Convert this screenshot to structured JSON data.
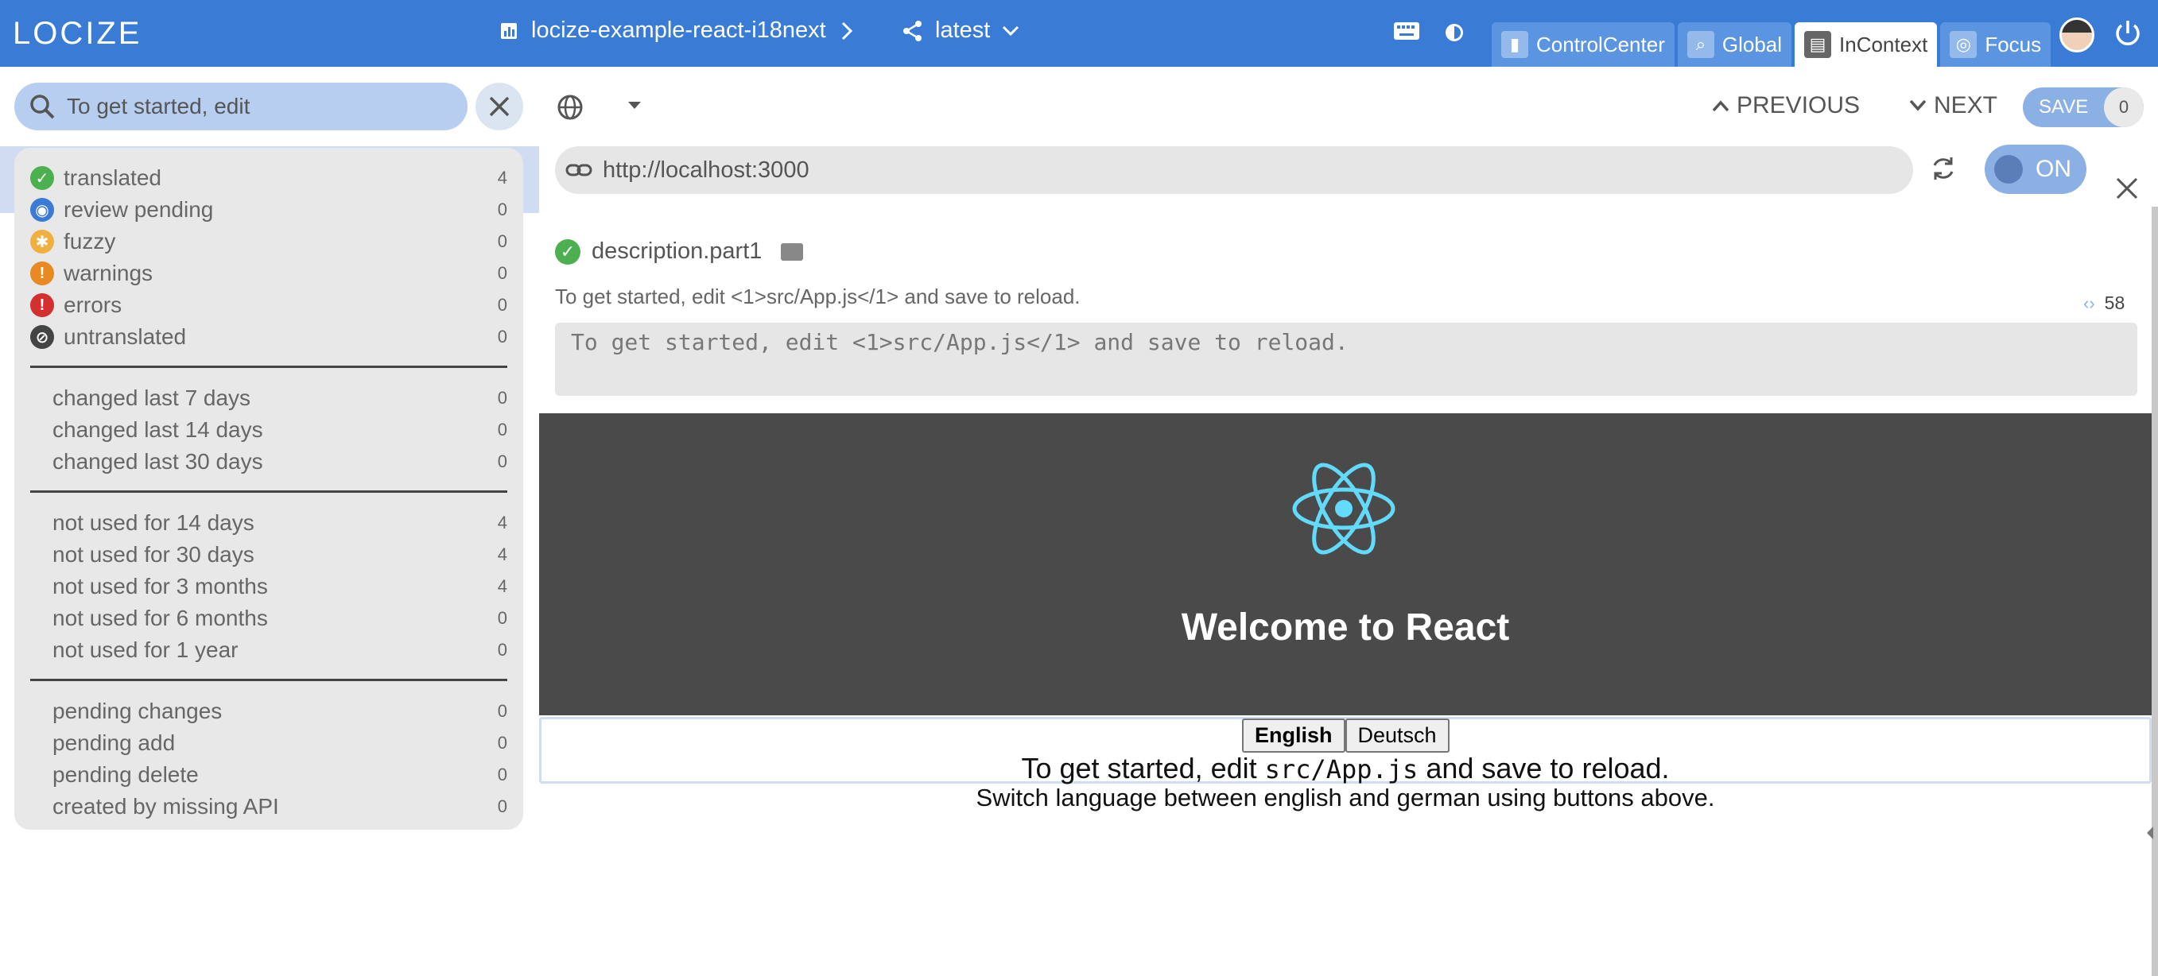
{
  "app": {
    "logo_text": "LOCIZE",
    "project_name": "locize-example-react-i18next",
    "version": "latest"
  },
  "mode_tabs": [
    {
      "label": "ControlCenter",
      "icon": "bar-chart-icon"
    },
    {
      "label": "Global",
      "icon": "search-icon"
    },
    {
      "label": "InContext",
      "icon": "incontext-icon",
      "active": true
    },
    {
      "label": "Focus",
      "icon": "focus-icon"
    }
  ],
  "search": {
    "value": "To get started, edit"
  },
  "filters": {
    "status": [
      {
        "label": "translated",
        "count": "4",
        "color": "#4caf50",
        "icon": "check-icon"
      },
      {
        "label": "review pending",
        "count": "0",
        "color": "#3a7bd5",
        "icon": "eye-icon"
      },
      {
        "label": "fuzzy",
        "count": "0",
        "color": "#f0b040",
        "icon": "bug-icon"
      },
      {
        "label": "warnings",
        "count": "0",
        "color": "#e88a20",
        "icon": "exclamation-icon"
      },
      {
        "label": "errors",
        "count": "0",
        "color": "#d32f2f",
        "icon": "exclamation-icon"
      },
      {
        "label": "untranslated",
        "count": "0",
        "color": "#444444",
        "icon": "blocked-icon"
      }
    ],
    "changed": [
      {
        "label": "changed last 7 days",
        "count": "0"
      },
      {
        "label": "changed last 14 days",
        "count": "0"
      },
      {
        "label": "changed last 30 days",
        "count": "0"
      }
    ],
    "unused": [
      {
        "label": "not used for 14 days",
        "count": "4"
      },
      {
        "label": "not used for 30 days",
        "count": "4"
      },
      {
        "label": "not used for 3 months",
        "count": "4"
      },
      {
        "label": "not used for 6 months",
        "count": "0"
      },
      {
        "label": "not used for 1 year",
        "count": "0"
      }
    ],
    "pending": [
      {
        "label": "pending changes",
        "count": "0"
      },
      {
        "label": "pending add",
        "count": "0"
      },
      {
        "label": "pending delete",
        "count": "0"
      },
      {
        "label": "created by missing API",
        "count": "0"
      }
    ]
  },
  "toolbar": {
    "previous_label": "PREVIOUS",
    "next_label": "NEXT",
    "save_label": "SAVE",
    "save_count": "0",
    "url": "http://localhost:3000",
    "toggle_label": "ON"
  },
  "key": {
    "name": "description.part1",
    "source_text": "To get started, edit <1>src/App.js</1> and save to reload.",
    "char_count": "58",
    "editor_value": "To get started, edit <1>src/App.js</1> and save to reload."
  },
  "preview": {
    "welcome": "Welcome to React",
    "lang_en": "English",
    "lang_de": "Deutsch",
    "line1_pre": "To get started, edit ",
    "line1_code": "src/App.js",
    "line1_post": " and save to reload.",
    "line2": "Switch language between english and german using buttons above."
  },
  "colors": {
    "brand": "#3a7bd5",
    "react_logo": "#61dafb"
  }
}
